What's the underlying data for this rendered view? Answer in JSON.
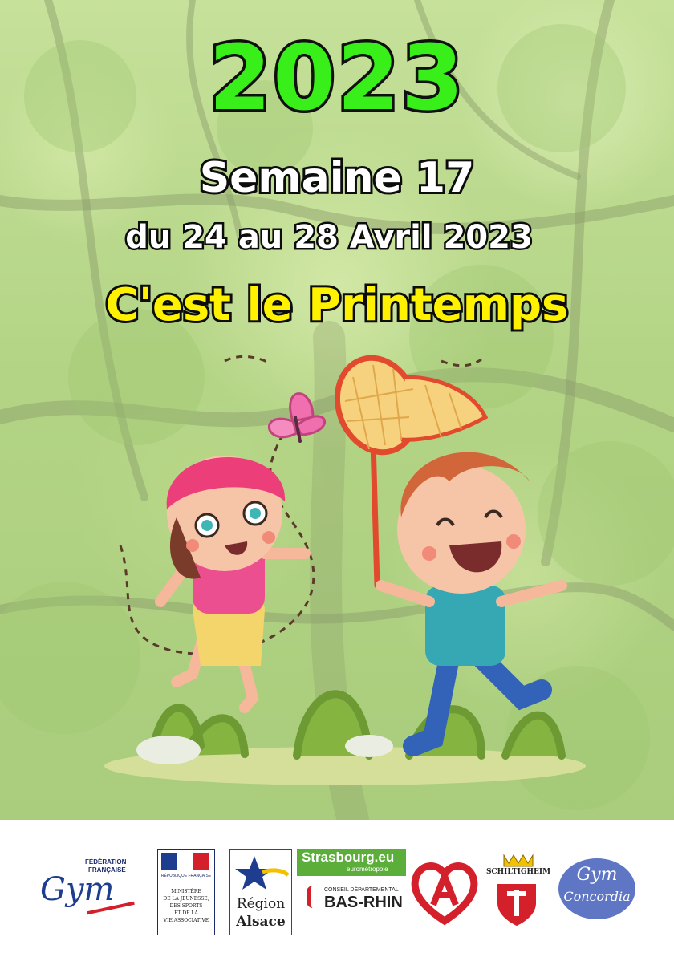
{
  "header": {
    "year": "2023",
    "week": "Semaine 17",
    "dates": "du 24 au 28 Avril 2023",
    "theme": "C'est le Printemps"
  },
  "colors": {
    "year_fill": "#39ef1a",
    "theme_fill": "#fff200",
    "outline": "#0c0c0c",
    "foliage": "#b3d485"
  },
  "illustration": {
    "subject": "two children chasing a butterfly with a net",
    "icons": [
      "butterfly-icon",
      "butterfly-net-icon",
      "girl-icon",
      "boy-icon",
      "grass-icon"
    ]
  },
  "sponsors": {
    "ffgym": {
      "top": "FÉDÉRATION",
      "sub": "FRANÇAISE",
      "name": "Gym"
    },
    "ministere": {
      "republique": "RÉPUBLIQUE FRANÇAISE",
      "lines": [
        "MINISTÈRE",
        "DE LA JEUNESSE,",
        "DES SPORTS",
        "ET DE LA",
        "VIE ASSOCIATIVE"
      ]
    },
    "region": {
      "line1": "Région",
      "line2": "Alsace"
    },
    "strasbourg": {
      "name": "Strasbourg.eu",
      "sub": "eurométropole"
    },
    "basrhin": {
      "top": "CONSEIL DÉPARTEMENTAL",
      "name": "BAS-RHIN"
    },
    "schiltigheim": {
      "name": "SCHILTIGHEIM"
    },
    "concordia": {
      "line1": "Gym",
      "line2": "Concordia"
    }
  }
}
